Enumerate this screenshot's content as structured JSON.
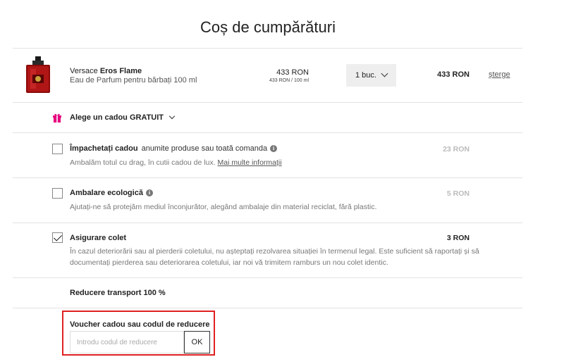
{
  "page": {
    "title": "Coș de cumpărături"
  },
  "product": {
    "brand": "Versace",
    "name": "Eros Flame",
    "description": "Eau de Parfum pentru bărbați 100 ml",
    "price": "433 RON",
    "unit_price": "433 RON / 100 ml",
    "quantity": "1 buc.",
    "total": "433 RON",
    "delete_label": "șterge"
  },
  "gift": {
    "label": "Alege un cadou GRATUIT",
    "icon": "gift-icon",
    "icon_color": "#e6007e"
  },
  "options": [
    {
      "title": "Împachetați cadou",
      "subtitle": "anumite produse sau toată comanda",
      "has_info": true,
      "description": "Ambalăm totul cu drag, în cutii cadou de lux.",
      "link": "Mai multe informații",
      "price": "23 RON",
      "checked": false
    },
    {
      "title": "Ambalare ecologică",
      "subtitle": "",
      "has_info": true,
      "description": "Ajutați-ne să protejăm mediul înconjurător, alegând ambalaje din material reciclat, fără plastic.",
      "link": "",
      "price": "5 RON",
      "checked": false
    },
    {
      "title": "Asigurare colet",
      "subtitle": "",
      "has_info": false,
      "description_line1": "În cazul deteriorării sau al pierderii coletului, nu așteptați rezolvarea situației în termenul legal. Este suficient să raportați și să",
      "description_line2": "documentați pierderea sau deteriorarea coletului, iar noi vă trimitem ramburs un nou colet identic.",
      "link": "",
      "price": "3 RON",
      "checked": true
    }
  ],
  "discount": {
    "label": "Reducere transport 100 %"
  },
  "voucher": {
    "label": "Voucher cadou sau codul de reducere",
    "placeholder": "Introdu codul de reducere",
    "value": "",
    "button_label": "OK",
    "highlight_color": "#e02020"
  }
}
